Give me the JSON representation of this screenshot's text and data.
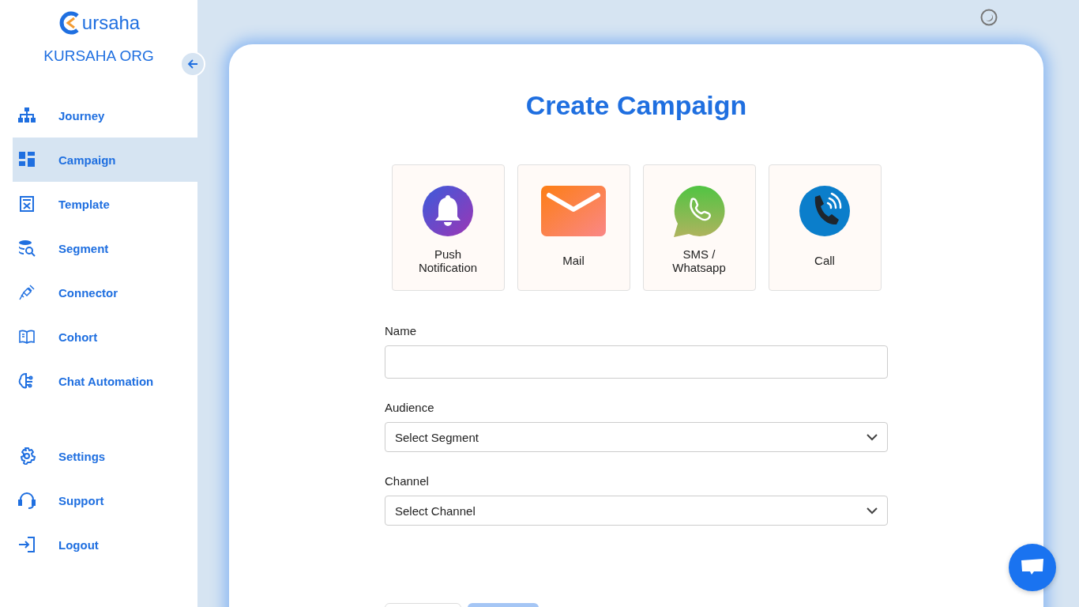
{
  "sidebar": {
    "logo_text": "ursaha",
    "org_name": "KURSAHA ORG",
    "main_items": [
      {
        "label": "Journey",
        "selected": false
      },
      {
        "label": "Campaign",
        "selected": true
      },
      {
        "label": "Template",
        "selected": false
      },
      {
        "label": "Segment",
        "selected": false
      },
      {
        "label": "Connector",
        "selected": false
      },
      {
        "label": "Cohort",
        "selected": false
      },
      {
        "label": "Chat Automation",
        "selected": false
      }
    ],
    "bottom_items": [
      {
        "label": "Settings",
        "selected": false
      },
      {
        "label": "Support",
        "selected": false
      },
      {
        "label": "Logout",
        "selected": false
      }
    ]
  },
  "form": {
    "title": "Create Campaign",
    "channels": [
      {
        "kind": "push",
        "label": "Push Notification",
        "selected": false
      },
      {
        "kind": "mail",
        "label": "Mail",
        "selected": false
      },
      {
        "kind": "whatsapp",
        "label": "SMS / Whatsapp",
        "selected": false
      },
      {
        "kind": "call",
        "label": "Call",
        "selected": false
      }
    ],
    "fields": [
      {
        "kind": "text",
        "label": "Name"
      },
      {
        "kind": "select",
        "label": "Audience",
        "placeholder": "Select Segment"
      },
      {
        "kind": "select",
        "label": "Channel",
        "placeholder": "Select Channel"
      }
    ]
  }
}
